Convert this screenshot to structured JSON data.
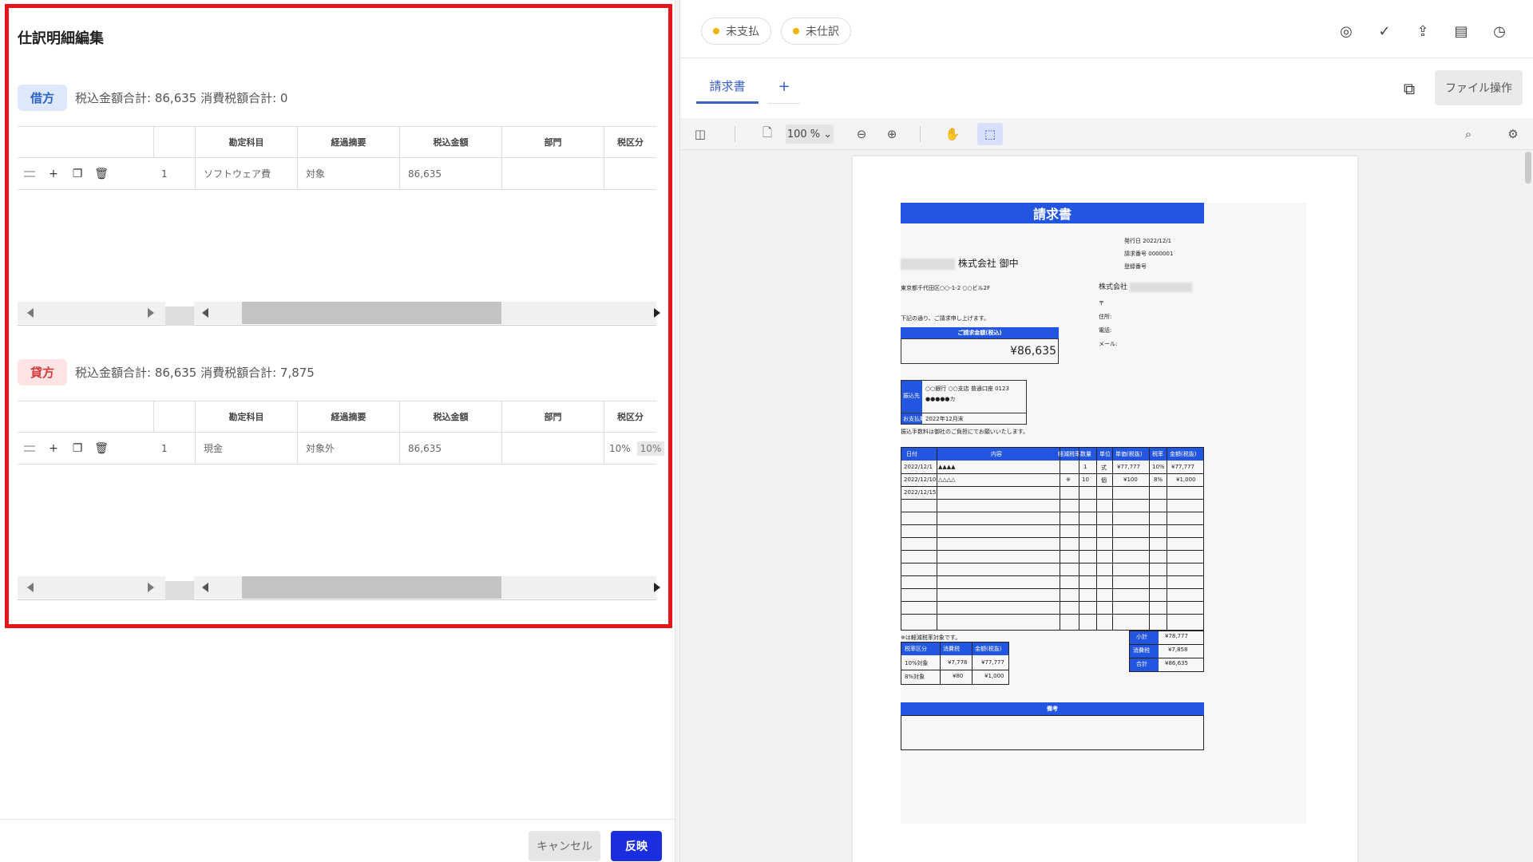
{
  "left_panel": {
    "title": "仕訳明細編集",
    "debit": {
      "badge": "借方",
      "summary": "税込金額合計: 86,635  消費税額合計: 0",
      "headers": [
        "勘定科目",
        "経過摘要",
        "税込金額",
        "部門",
        "税区分"
      ],
      "row": {
        "no": "1",
        "account": "ソフトウェア費",
        "summary": "対象",
        "amount": "86,635",
        "dept": "",
        "tax": ""
      }
    },
    "credit": {
      "badge": "貸方",
      "summary": "税込金額合計: 86,635  消費税額合計: 7,875",
      "headers": [
        "勘定科目",
        "経過摘要",
        "税込金額",
        "部門",
        "税区分"
      ],
      "row": {
        "no": "1",
        "account": "現金",
        "summary": "対象外",
        "amount": "86,635",
        "dept": "",
        "tax": "10%",
        "tax_box": "10%"
      }
    },
    "footer": {
      "cancel": "キャンセル",
      "apply": "反映"
    }
  },
  "right_panel": {
    "tags": [
      "未支払",
      "未仕訳"
    ],
    "tab": "請求書",
    "tab_add": "+",
    "file_button": "ファイル操作",
    "zoom": "100 %",
    "invoice": {
      "title": "請求書",
      "meta_labels": [
        "発行日",
        "請求番号",
        "登録番号"
      ],
      "meta_values": [
        "2022/12/1",
        "0000001",
        ""
      ],
      "to": "株式会社 御中",
      "address": "東京都千代田区○○-1-2 ○○ビル2F",
      "from_company": "株式会社",
      "from_lines": [
        "〒",
        "住所:",
        "電話:",
        "メール:"
      ],
      "intro": "下記の通り、ご請求申し上げます。",
      "amount_label": "ご請求金額(税込)",
      "amount": "¥86,635",
      "bank_label": "振込先",
      "bank_lines": [
        "○○銀行 ○○支店 普通口座 0123",
        "●●●●●カ"
      ],
      "due_label": "お支払期限",
      "due_value": "2022年12月末",
      "fee_note": "振込手数料は御社のご負担にてお願いいたします。",
      "table_headers": [
        "日付",
        "内容",
        "軽減税率",
        "数量",
        "単位",
        "単価(税抜)",
        "税率",
        "金額(税抜)"
      ],
      "rows": [
        [
          "2022/12/1",
          "▲▲▲▲",
          "",
          "1",
          "式",
          "¥77,777",
          "10%",
          "¥77,777"
        ],
        [
          "2022/12/10",
          "△△△△",
          "※",
          "10",
          "個",
          "¥100",
          "8%",
          "¥1,000"
        ],
        [
          "2022/12/15",
          "",
          "",
          "",
          "",
          "",
          "",
          ""
        ]
      ],
      "reduced_note": "※は軽減税率対象です。",
      "tax_headers": [
        "税率区分",
        "消費税",
        "金額(税抜)"
      ],
      "tax_rows": [
        [
          "10%対象",
          "¥7,778",
          "¥77,777"
        ],
        [
          "8%対象",
          "¥80",
          "¥1,000"
        ]
      ],
      "totals_labels": [
        "小計",
        "消費税",
        "合計"
      ],
      "totals_values": [
        "¥78,777",
        "¥7,858",
        "¥86,635"
      ],
      "notes_label": "備考"
    }
  }
}
